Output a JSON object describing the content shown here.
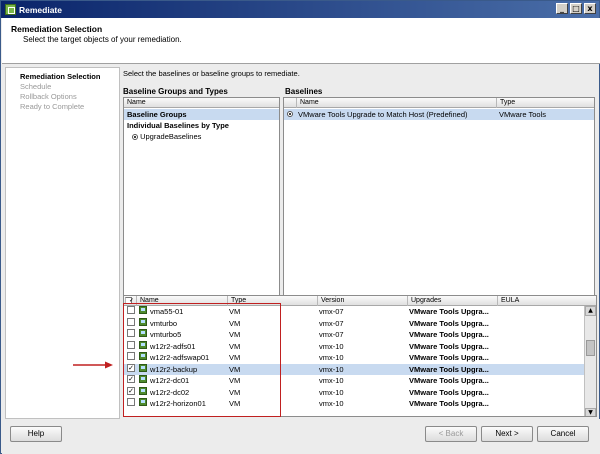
{
  "window": {
    "title": "Remediate",
    "buttons": [
      "_",
      "□",
      "x"
    ]
  },
  "header": {
    "title": "Remediation Selection",
    "subtitle": "Select the target objects of your remediation."
  },
  "steps": [
    {
      "label": "Remediation Selection",
      "active": true
    },
    {
      "label": "Schedule",
      "active": false
    },
    {
      "label": "Rollback Options",
      "active": false
    },
    {
      "label": "Ready to Complete",
      "active": false
    }
  ],
  "main": {
    "instruction": "Select the baselines or baseline groups to remediate.",
    "left_pane": {
      "title": "Baseline Groups and Types",
      "column": "Name",
      "baseline_groups": "Baseline Groups",
      "individual": "Individual Baselines by Type",
      "upgrade": "UpgradeBaselines"
    },
    "right_pane": {
      "title": "Baselines",
      "columns": {
        "name": "Name",
        "type": "Type"
      },
      "row": {
        "name": "VMware Tools Upgrade to Match Host (Predefined)",
        "type": "VMware Tools"
      }
    }
  },
  "vm_table": {
    "columns": {
      "name": "Name",
      "type": "Type",
      "version": "Version",
      "upgrades": "Upgrades",
      "eula": "EULA"
    },
    "rows": [
      {
        "name": "vma55-01",
        "type": "VM",
        "version": "vmx-07",
        "upgrades": "VMware Tools Upgra...",
        "checked": false
      },
      {
        "name": "vmturbo",
        "type": "VM",
        "version": "vmx-07",
        "upgrades": "VMware Tools Upgra...",
        "checked": false
      },
      {
        "name": "vmturbo5",
        "type": "VM",
        "version": "vmx-07",
        "upgrades": "VMware Tools Upgra...",
        "checked": false
      },
      {
        "name": "w12r2-adfs01",
        "type": "VM",
        "version": "vmx-10",
        "upgrades": "VMware Tools Upgra...",
        "checked": false
      },
      {
        "name": "w12r2-adfswap01",
        "type": "VM",
        "version": "vmx-10",
        "upgrades": "VMware Tools Upgra...",
        "checked": false
      },
      {
        "name": "w12r2-backup",
        "type": "VM",
        "version": "vmx-10",
        "upgrades": "VMware Tools Upgra...",
        "checked": true
      },
      {
        "name": "w12r2-dc01",
        "type": "VM",
        "version": "vmx-10",
        "upgrades": "VMware Tools Upgra...",
        "checked": true
      },
      {
        "name": "w12r2-dc02",
        "type": "VM",
        "version": "vmx-10",
        "upgrades": "VMware Tools Upgra...",
        "checked": true
      },
      {
        "name": "w12r2-horizon01",
        "type": "VM",
        "version": "vmx-10",
        "upgrades": "VMware Tools Upgra...",
        "checked": false
      }
    ]
  },
  "footer": {
    "help": "Help",
    "back": "< Back",
    "next": "Next >",
    "cancel": "Cancel"
  },
  "colors": {
    "titlebar": "#0a246a",
    "selection": "#c8daf0",
    "highlight": "#c02020",
    "vm_icon": "#4f8b2e"
  }
}
